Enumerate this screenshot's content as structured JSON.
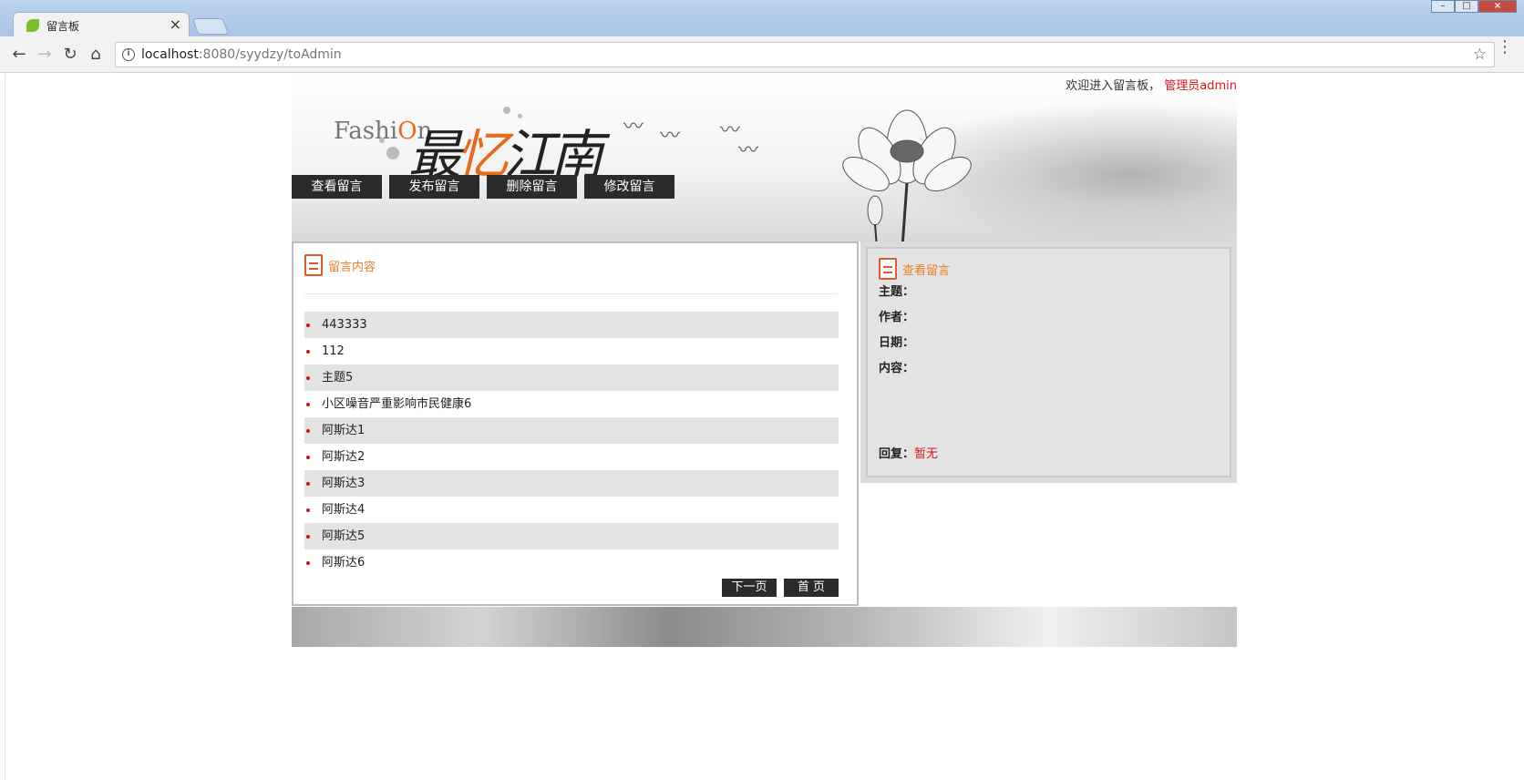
{
  "browser": {
    "tab_title": "留言板",
    "tab_close": "×",
    "url_host": "localhost",
    "url_rest": ":8080/syydzy/toAdmin",
    "back": "←",
    "forward": "→",
    "reload": "↻",
    "home": "⌂",
    "star": "☆",
    "menu": "⋮",
    "win_min": "–",
    "win_max": "□",
    "win_close": "×"
  },
  "header": {
    "welcome_text": "欢迎进入留言板，",
    "admin_text": "管理员admin",
    "logo_fashion_pre": "Fashi",
    "logo_fashion_o": "O",
    "logo_fashion_post": "n",
    "logo_cn_1": "最",
    "logo_cn_2": "忆",
    "logo_cn_3": "江南"
  },
  "nav": {
    "items": [
      "查看留言",
      "发布留言",
      "删除留言",
      "修改留言"
    ]
  },
  "left_panel": {
    "title": "留言内容",
    "messages": [
      "443333",
      "112",
      "主题5",
      "小区噪音严重影响市民健康6",
      "阿斯达1",
      "阿斯达2",
      "阿斯达3",
      "阿斯达4",
      "阿斯达5",
      "阿斯达6"
    ],
    "next_page": "下一页",
    "first_page": "首 页"
  },
  "right_panel": {
    "title": "查看留言",
    "subject_label": "主题：",
    "author_label": "作者：",
    "date_label": "日期：",
    "content_label": "内容：",
    "reply_label": "回复：",
    "reply_value": "暂无"
  },
  "colors": {
    "accent_orange": "#e8822a",
    "admin_red": "#e0131a",
    "nav_bg": "#2b2b2b"
  }
}
